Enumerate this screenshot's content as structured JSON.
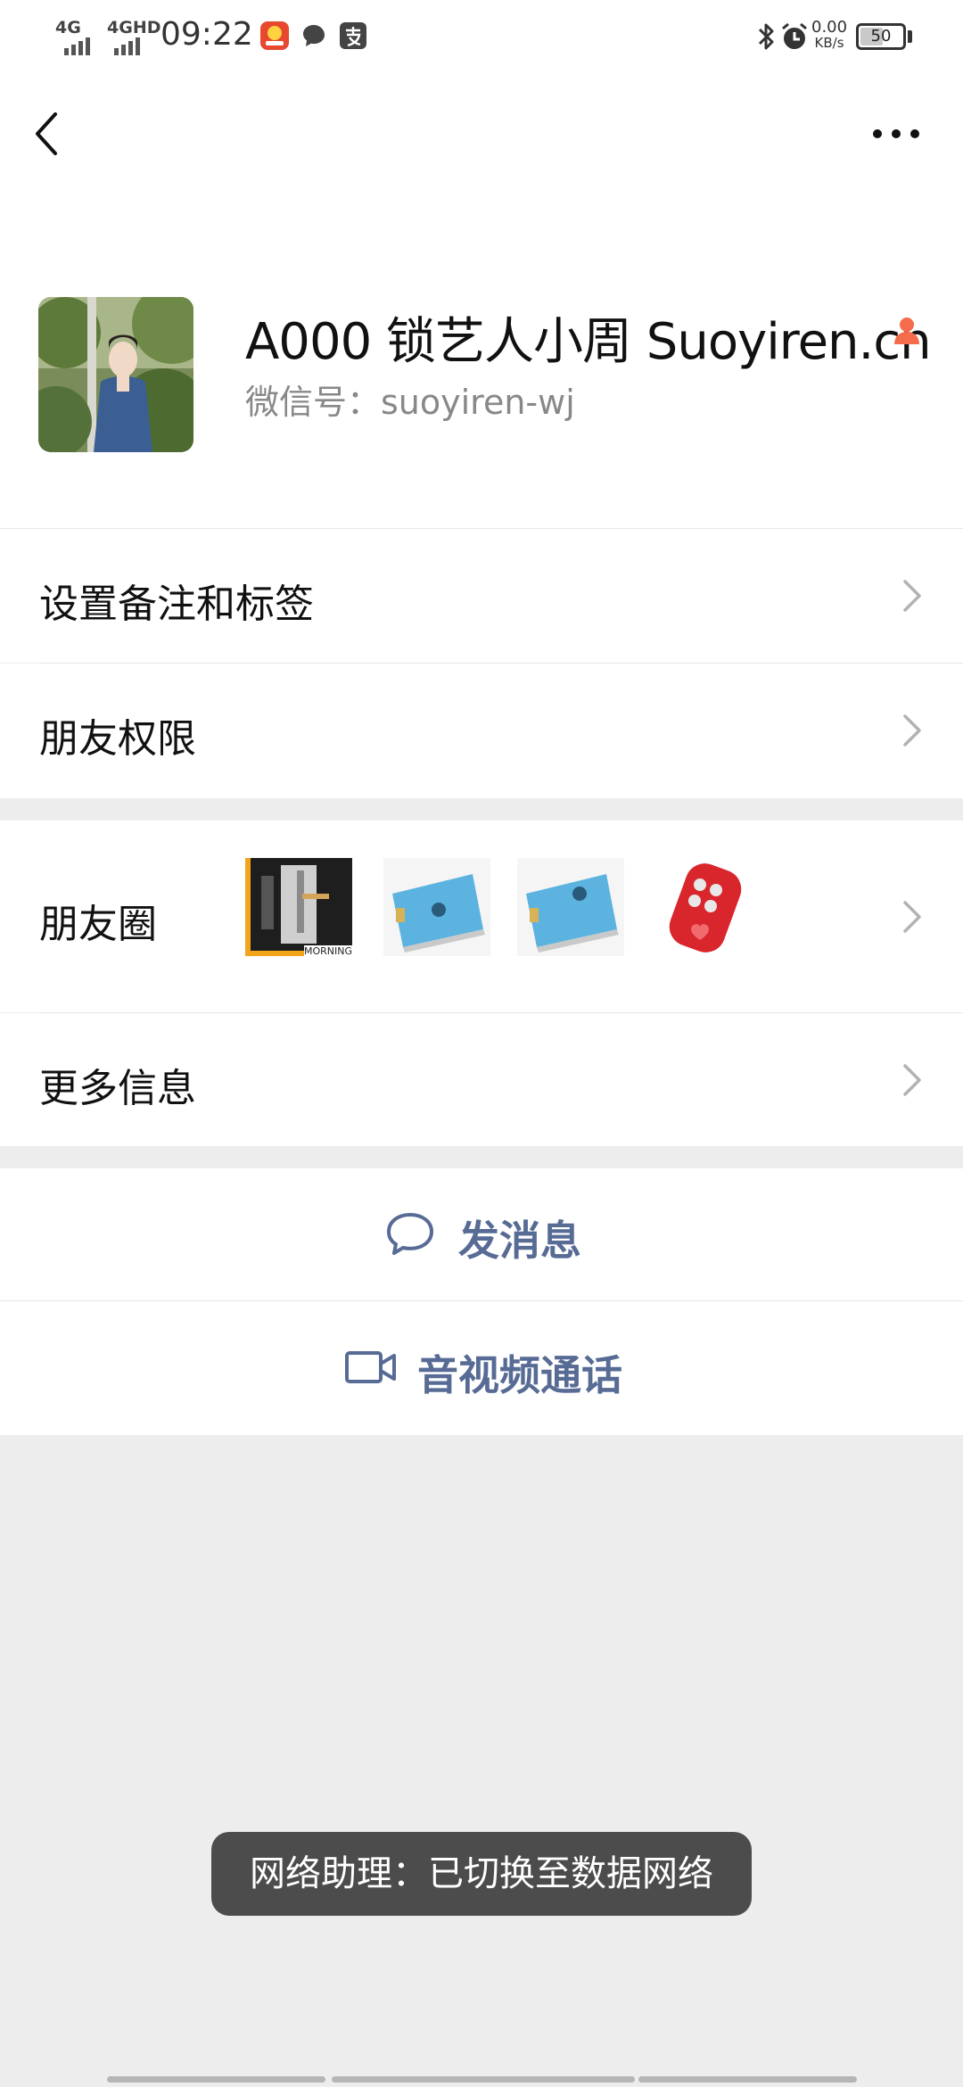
{
  "status_bar": {
    "network_1": "4G",
    "network_2": "4GHD",
    "time": "09:22",
    "speed_value": "0.00",
    "speed_unit": "KB/s",
    "battery_level": "50",
    "battery_fraction": 0.5,
    "icons": [
      "signal-icon",
      "notification-app-icon",
      "message-bubble-icon",
      "alipay-icon",
      "bluetooth-icon",
      "alarm-icon"
    ]
  },
  "header": {
    "back_icon": "chevron-left-icon",
    "more_icon": "ellipsis-icon"
  },
  "profile": {
    "name": "A000 锁艺人小周 Suoyiren.cn",
    "wechat_id": "微信号：suoyiren-wj",
    "gender_icon": "female-person-icon",
    "gender_color": "#f56c4c"
  },
  "menu": {
    "remark_label": "设置备注和标签",
    "permission_label": "朋友权限",
    "moments_label": "朋友圈",
    "moments_thumbnail_caption": "MORNING",
    "more_info_label": "更多信息"
  },
  "actions": {
    "message_label": "发消息",
    "call_label": "音视频通话",
    "accent_color": "#576b95"
  },
  "toast": {
    "text": "网络助理：已切换至数据网络"
  }
}
